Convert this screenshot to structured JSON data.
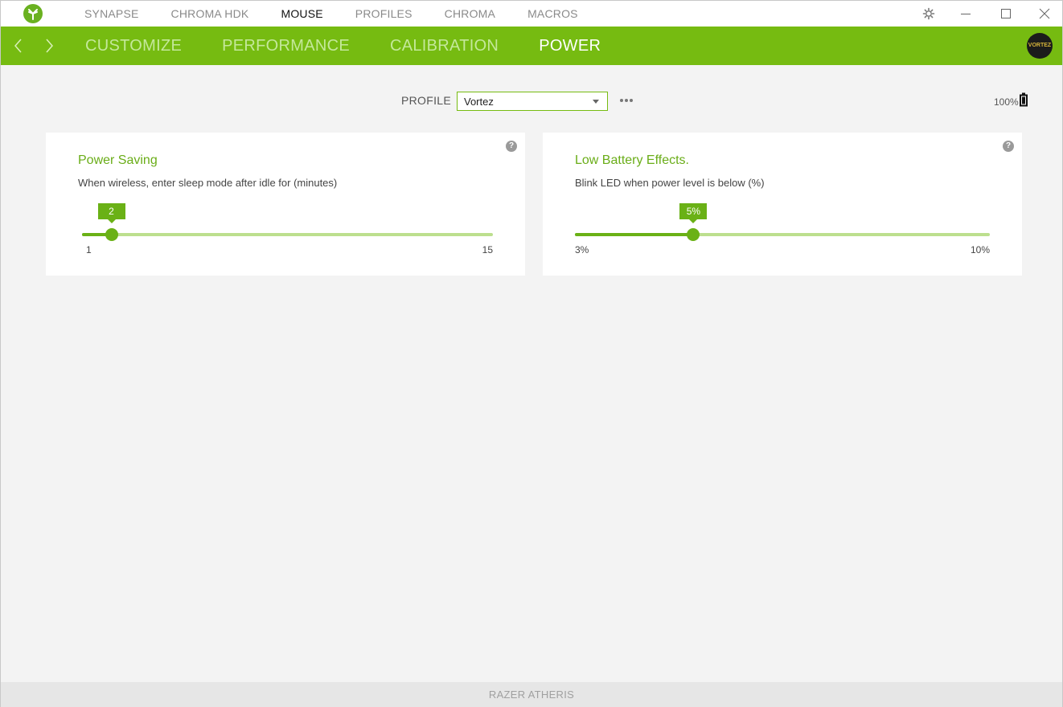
{
  "top_nav": {
    "items": [
      "SYNAPSE",
      "CHROMA HDK",
      "MOUSE",
      "PROFILES",
      "CHROMA",
      "MACROS"
    ],
    "active": "MOUSE"
  },
  "sub_nav": {
    "items": [
      "CUSTOMIZE",
      "PERFORMANCE",
      "CALIBRATION",
      "POWER"
    ],
    "active": "POWER"
  },
  "avatar_text": "VORTEZ",
  "profile": {
    "label": "PROFILE",
    "selected": "Vortez"
  },
  "battery": {
    "percent_label": "100%"
  },
  "power_saving": {
    "title": "Power Saving",
    "description": "When wireless, enter sleep mode after idle for (minutes)",
    "value": 2,
    "value_label": "2",
    "min": 1,
    "max": 15,
    "min_label": "1",
    "max_label": "15"
  },
  "low_battery": {
    "title": "Low Battery Effects.",
    "description": "Blink LED when power level is below (%)",
    "value": 5,
    "value_label": "5%",
    "min": 3,
    "max": 10,
    "min_label": "3%",
    "max_label": "10%"
  },
  "footer": {
    "device_name": "RAZER ATHERIS"
  },
  "colors": {
    "accent": "#76bb11",
    "slider_fill": "#6ab116",
    "slider_track": "#bcdf8e"
  },
  "icons": [
    "razer-logo-icon",
    "settings-icon",
    "minimize-icon",
    "maximize-icon",
    "close-icon",
    "back-arrow-icon",
    "forward-arrow-icon",
    "dropdown-caret-icon",
    "more-options-icon",
    "battery-icon",
    "help-icon"
  ]
}
